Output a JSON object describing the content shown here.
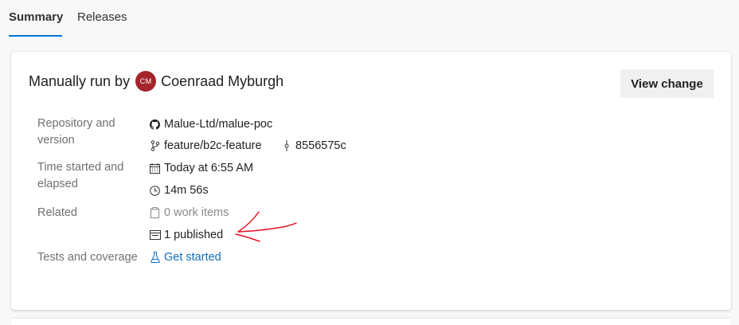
{
  "tabs": [
    {
      "label": "Summary",
      "active": true
    },
    {
      "label": "Releases",
      "active": false
    }
  ],
  "header": {
    "prefix": "Manually run by",
    "avatar_initials": "CM",
    "avatar_color": "#a4262c",
    "user_name": "Coenraad Myburgh",
    "view_change_label": "View change"
  },
  "details": {
    "repo_label": "Repository and version",
    "repo_name": "Malue-Ltd/malue-poc",
    "branch": "feature/b2c-feature",
    "commit": "8556575c",
    "time_label": "Time started and elapsed",
    "started": "Today at 6:55 AM",
    "elapsed": "14m 56s",
    "related_label": "Related",
    "work_items": "0 work items",
    "published": "1 published",
    "tests_label": "Tests and coverage",
    "tests_link": "Get started"
  },
  "colors": {
    "accent": "#0078d4",
    "link": "#106ebe",
    "annotation": "#e81123"
  },
  "icons": {
    "repo": "github-icon",
    "branch": "branch-icon",
    "commit": "commit-icon",
    "calendar": "calendar-icon",
    "clock": "clock-icon",
    "work_items": "clipboard-icon",
    "artifact": "artifact-icon",
    "tests": "flask-icon"
  }
}
